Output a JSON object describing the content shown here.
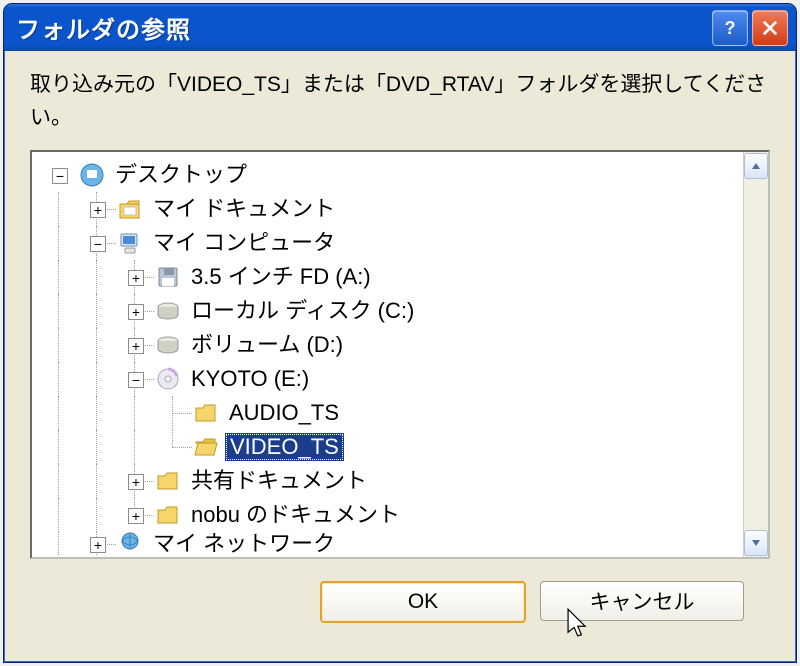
{
  "title": "フォルダの参照",
  "instruction": "取り込み元の「VIDEO_TS」または「DVD_RTAV」フォルダを選択してください。",
  "tree": {
    "desktop": "デスクトップ",
    "mydocs": "マイ ドキュメント",
    "mycomputer": "マイ コンピュータ",
    "floppy": "3.5 インチ FD (A:)",
    "cdrive": "ローカル ディスク (C:)",
    "ddrive": "ボリューム (D:)",
    "edrive": "KYOTO (E:)",
    "audio_ts": "AUDIO_TS",
    "video_ts": "VIDEO_TS",
    "shareddocs": "共有ドキュメント",
    "nobudocs": "nobu のドキュメント",
    "mynetwork": "マイ ネットワーク"
  },
  "buttons": {
    "ok": "OK",
    "cancel": "キャンセル"
  }
}
